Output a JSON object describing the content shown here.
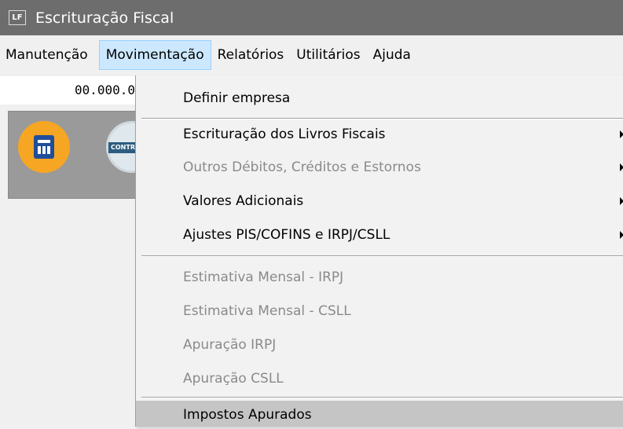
{
  "window": {
    "app_icon_text": "LF",
    "title": "Escrituração Fiscal"
  },
  "menubar": {
    "items": [
      {
        "label": "Manutenção"
      },
      {
        "label": "Movimentação"
      },
      {
        "label": "Relatórios"
      },
      {
        "label": "Utilitários"
      },
      {
        "label": "Ajuda"
      }
    ]
  },
  "field": {
    "value": "00.000.0"
  },
  "toolbar": {
    "contributor_icon_text": "CONTRI"
  },
  "dropdown": {
    "items": [
      {
        "label": "Definir empresa"
      },
      {
        "label": "Escrituração dos Livros Fiscais"
      },
      {
        "label": "Outros Débitos, Créditos e Estornos"
      },
      {
        "label": "Valores Adicionais"
      },
      {
        "label": "Ajustes PIS/COFINS e IRPJ/CSLL"
      },
      {
        "label": "Estimativa Mensal - IRPJ"
      },
      {
        "label": "Estimativa Mensal - CSLL"
      },
      {
        "label": "Apuração IRPJ"
      },
      {
        "label": "Apuração CSLL"
      },
      {
        "label": "Impostos Apurados"
      }
    ]
  },
  "colors": {
    "titlebar": "#6d6d6d",
    "menu_active": "#cce8ff",
    "highlight": "#c5c5c5",
    "disabled_text": "#8a8a8a"
  }
}
